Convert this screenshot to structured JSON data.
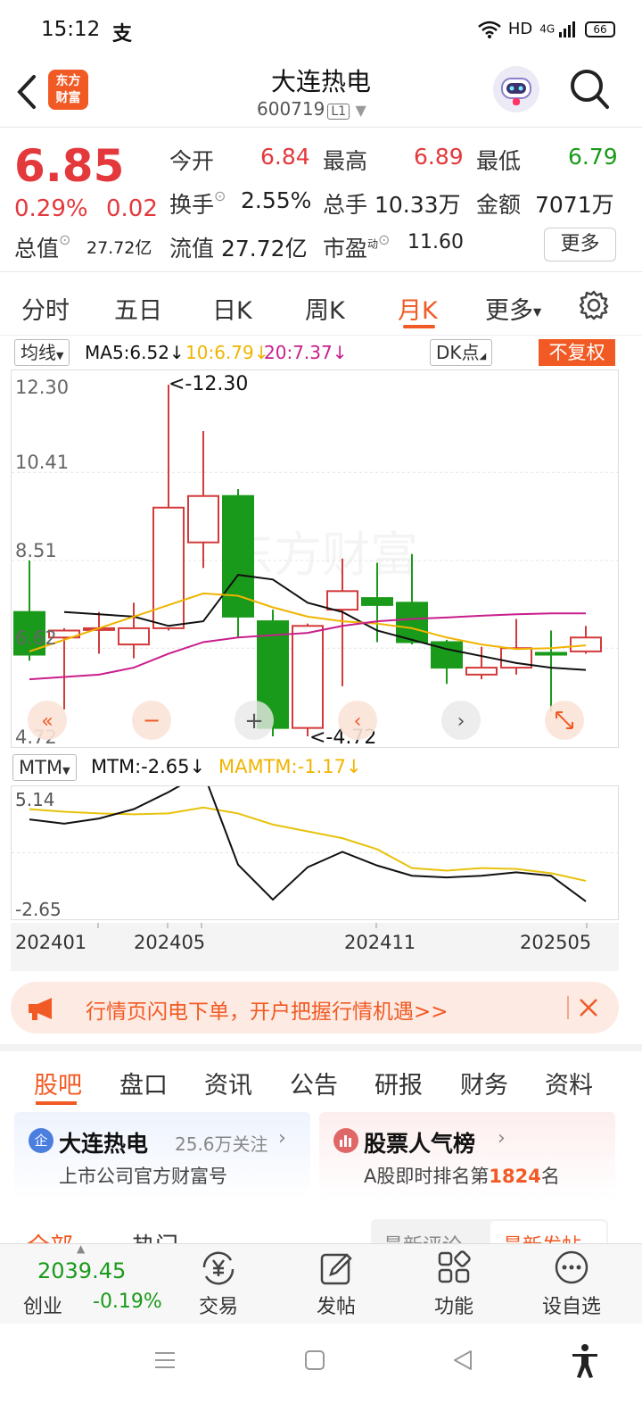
{
  "status_bar": {
    "time": "15:12",
    "alipay": "支",
    "network": "HD",
    "signal": "4G",
    "battery": "66"
  },
  "header": {
    "title": "大连热电",
    "code": "600719",
    "level_badge": "L1",
    "logo_line1": "东方",
    "logo_line2": "财富"
  },
  "quote": {
    "price": "6.85",
    "change_pct": "0.29%",
    "change": "0.02",
    "open_label": "今开",
    "open": "6.84",
    "high_label": "最高",
    "high": "6.89",
    "low_label": "最低",
    "low": "6.79",
    "turnover_label": "换手",
    "turnover": "2.55%",
    "volume_label": "总手",
    "volume": "10.33万",
    "amount_label": "金额",
    "amount": "7071万",
    "mktcap_label": "总值",
    "mktcap": "27.72亿",
    "float_label": "流值",
    "float": "27.72亿",
    "pe_label": "市盈",
    "pe_sup": "动",
    "pe": "11.60",
    "more": "更多"
  },
  "period_tabs": [
    "分时",
    "五日",
    "日K",
    "周K",
    "月K",
    "更多"
  ],
  "active_period": "月K",
  "ma_row": {
    "ma_select": "均线",
    "ma5": "MA5:6.52↓",
    "ma10": "10:6.79↓",
    "ma20": "20:7.37↓",
    "dk": "DK点",
    "fuquan": "不复权"
  },
  "kchart": {
    "y_labels": [
      "12.30",
      "10.41",
      "8.51",
      "6.62",
      "4.72"
    ],
    "max_label": "<-12.30",
    "min_label": "<-4.72",
    "watermark": "东方财富"
  },
  "indicator_row": {
    "select": "MTM",
    "mtm": "MTM:-2.65↓",
    "mamtm": "MAMTM:-1.17↓"
  },
  "mtm_chart": {
    "y_labels": [
      "5.14",
      "-2.65"
    ]
  },
  "dates": [
    "202401",
    "202405",
    "202411",
    "202505"
  ],
  "banner": {
    "text": "行情页闪电下单，开户把握行情机遇>>"
  },
  "sub_tabs": [
    "股吧",
    "盘口",
    "资讯",
    "公告",
    "研报",
    "财务",
    "资料"
  ],
  "cards": {
    "left_badge": "企",
    "left_title": "大连热电",
    "left_followers": "25.6万关注",
    "left_sub": "上市公司官方财富号",
    "right_title": "股票人气榜",
    "right_sub_pre": "A股即时排名第",
    "right_rank": "1824",
    "right_sub_post": "名"
  },
  "cut_row": {
    "tab1": "全部",
    "tab2": "热门",
    "sort1": "最新评论",
    "sort2": "最新发帖"
  },
  "bottom_nav": {
    "index_value": "2039.45",
    "index_name": "创业",
    "index_change": "-0.19%",
    "trade": "交易",
    "post": "发帖",
    "func": "功能",
    "watch": "设自选"
  },
  "colors": {
    "up": "#e4393c",
    "down": "#1a9a1a",
    "accent": "#f15a24",
    "ma5": "#111111",
    "ma10": "#f0b400",
    "ma20": "#c81e8c"
  }
}
